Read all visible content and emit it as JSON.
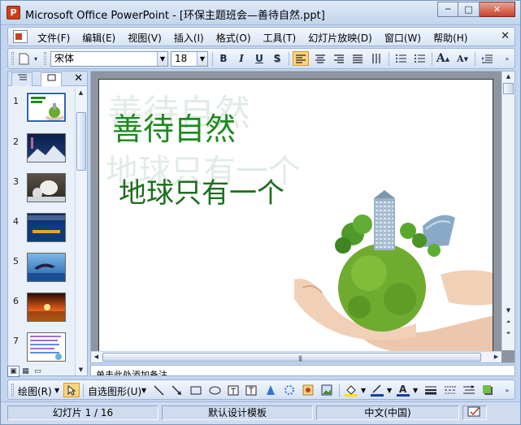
{
  "window": {
    "title": "Microsoft Office PowerPoint - [环保主题班会—善待自然.ppt]",
    "app_icon": "P",
    "buttons": {
      "minimize": "─",
      "maximize": "□",
      "close": "✕"
    }
  },
  "menubar": {
    "items": [
      "文件(F)",
      "编辑(E)",
      "视图(V)",
      "插入(I)",
      "格式(O)",
      "工具(T)",
      "幻灯片放映(D)",
      "窗口(W)",
      "帮助(H)"
    ],
    "close_glyph": "✕"
  },
  "format_toolbar": {
    "font_name": "宋体",
    "font_size": "18",
    "bold": "B",
    "italic": "I",
    "underline": "U",
    "shadow": "S",
    "grow_font": "A",
    "shrink_font": "A"
  },
  "left_panel": {
    "close_glyph": "✕",
    "slides": [
      {
        "number": "1"
      },
      {
        "number": "2"
      },
      {
        "number": "3"
      },
      {
        "number": "4"
      },
      {
        "number": "5"
      },
      {
        "number": "6"
      },
      {
        "number": "7"
      }
    ]
  },
  "slide": {
    "title": "善待自然",
    "subtitle": "地球只有一个",
    "watermark_title": "善待自然",
    "watermark_subtitle": "地球只有一个"
  },
  "notes": {
    "placeholder": "单击此处添加备注"
  },
  "drawing_toolbar": {
    "draw_label": "绘图(R)",
    "autoshapes_label": "自选图形(U)"
  },
  "statusbar": {
    "slide_position": "幻灯片 1 / 16",
    "design_template": "默认设计模板",
    "language": "中文(中国)"
  },
  "colors": {
    "title_green": "#1c8a1c",
    "accent_orange": "#ffd37a",
    "office_blue": "#c4d6ef"
  }
}
